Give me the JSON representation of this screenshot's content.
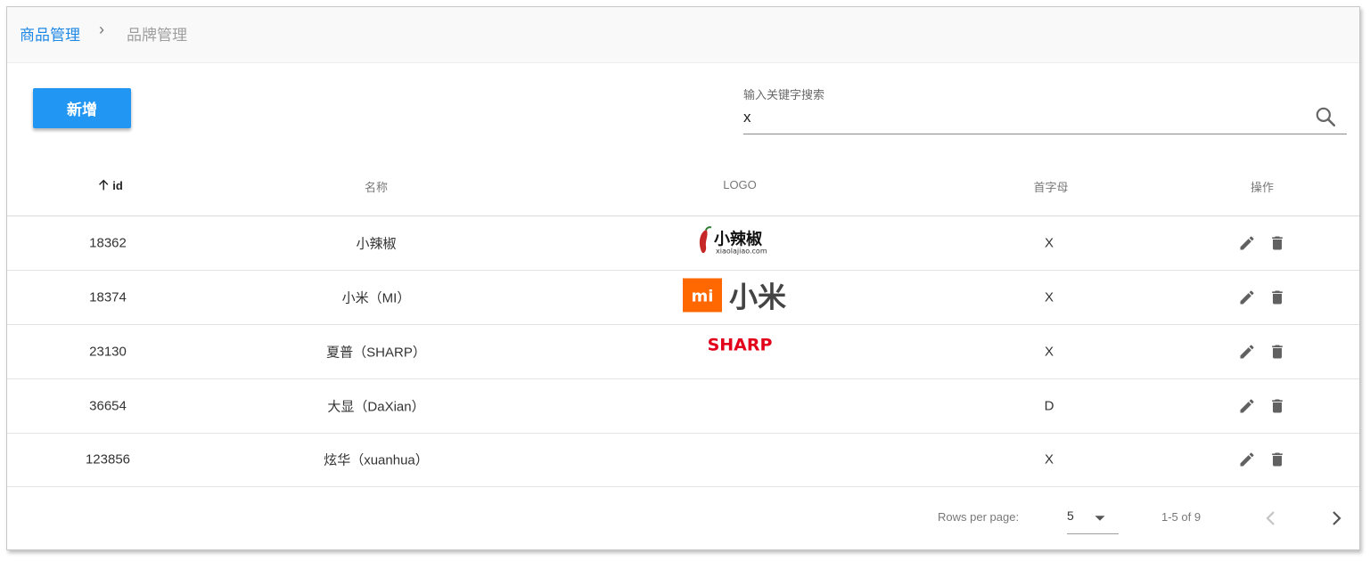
{
  "breadcrumb": {
    "parent": "商品管理",
    "separator": "›",
    "current": "品牌管理"
  },
  "toolbar": {
    "add_label": "新增"
  },
  "search": {
    "label": "输入关键字搜索",
    "value": "x"
  },
  "table": {
    "headers": {
      "id": "id",
      "name": "名称",
      "logo": "LOGO",
      "letter": "首字母",
      "actions": "操作"
    },
    "sort": {
      "column": "id",
      "direction": "ascending"
    },
    "rows": [
      {
        "id": "18362",
        "name": "小辣椒",
        "letter": "X",
        "logo": "xiaolajiao-logo",
        "logo_text": "小辣椒",
        "logo_sub": "xiaolajiao.com"
      },
      {
        "id": "18374",
        "name": "小米（MI）",
        "letter": "X",
        "logo": "xiaomi-logo",
        "logo_text": "小米",
        "logo_mark": "mi"
      },
      {
        "id": "23130",
        "name": "夏普（SHARP）",
        "letter": "X",
        "logo": "sharp-logo",
        "logo_text": "SHARP"
      },
      {
        "id": "36654",
        "name": "大显（DaXian）",
        "letter": "D",
        "logo": ""
      },
      {
        "id": "123856",
        "name": "炫华（xuanhua）",
        "letter": "X",
        "logo": ""
      }
    ]
  },
  "pagination": {
    "rows_per_page_label": "Rows per page:",
    "rows_per_page": "5",
    "range": "1-5 of 9"
  },
  "colors": {
    "accent": "#2196f3",
    "link": "#1e88e5",
    "xiaomi": "#ff6700",
    "sharp": "#e2001a"
  },
  "icons": [
    "chevron-right-icon",
    "search-icon",
    "arrow-up-icon",
    "edit-icon",
    "delete-icon",
    "dropdown-arrow-icon",
    "chevron-left-icon"
  ]
}
